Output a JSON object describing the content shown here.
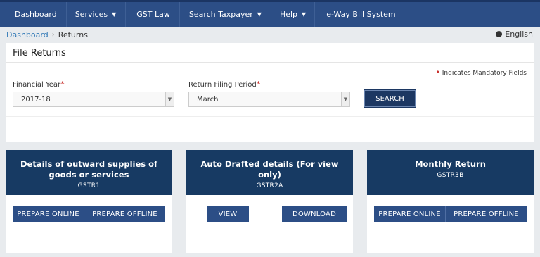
{
  "nav": {
    "items": [
      {
        "label": "Dashboard",
        "dropdown": false
      },
      {
        "label": "Services",
        "dropdown": true
      },
      {
        "label": "GST Law",
        "dropdown": false
      },
      {
        "label": "Search Taxpayer",
        "dropdown": true
      },
      {
        "label": "Help",
        "dropdown": true
      },
      {
        "label": "e-Way Bill System",
        "dropdown": false
      }
    ],
    "caret_icon": "caret-down-icon"
  },
  "breadcrumb": {
    "link": "Dashboard",
    "current": "Returns"
  },
  "language": {
    "label": "English",
    "icon": "globe-icon"
  },
  "file_returns": {
    "title": "File Returns",
    "mandatory_note": "Indicates Mandatory Fields",
    "financial_year": {
      "label": "Financial Year",
      "value": "2017-18"
    },
    "filing_period": {
      "label": "Return Filing Period",
      "value": "March"
    },
    "search_label": "SEARCH"
  },
  "cards": [
    {
      "title": "Details of outward supplies of goods or services",
      "code": "GSTR1",
      "buttons": [
        "PREPARE ONLINE",
        "PREPARE OFFLINE"
      ]
    },
    {
      "title": "Auto Drafted details (For view only)",
      "code": "GSTR2A",
      "buttons": [
        "VIEW",
        "DOWNLOAD"
      ]
    },
    {
      "title": "Monthly Return",
      "code": "GSTR3B",
      "buttons": [
        "PREPARE ONLINE",
        "PREPARE OFFLINE"
      ]
    }
  ],
  "colors": {
    "nav_bg": "#2c4e86",
    "card_header": "#173a63",
    "button": "#2c4e86",
    "required": "#c9302c",
    "link": "#337ab7"
  }
}
